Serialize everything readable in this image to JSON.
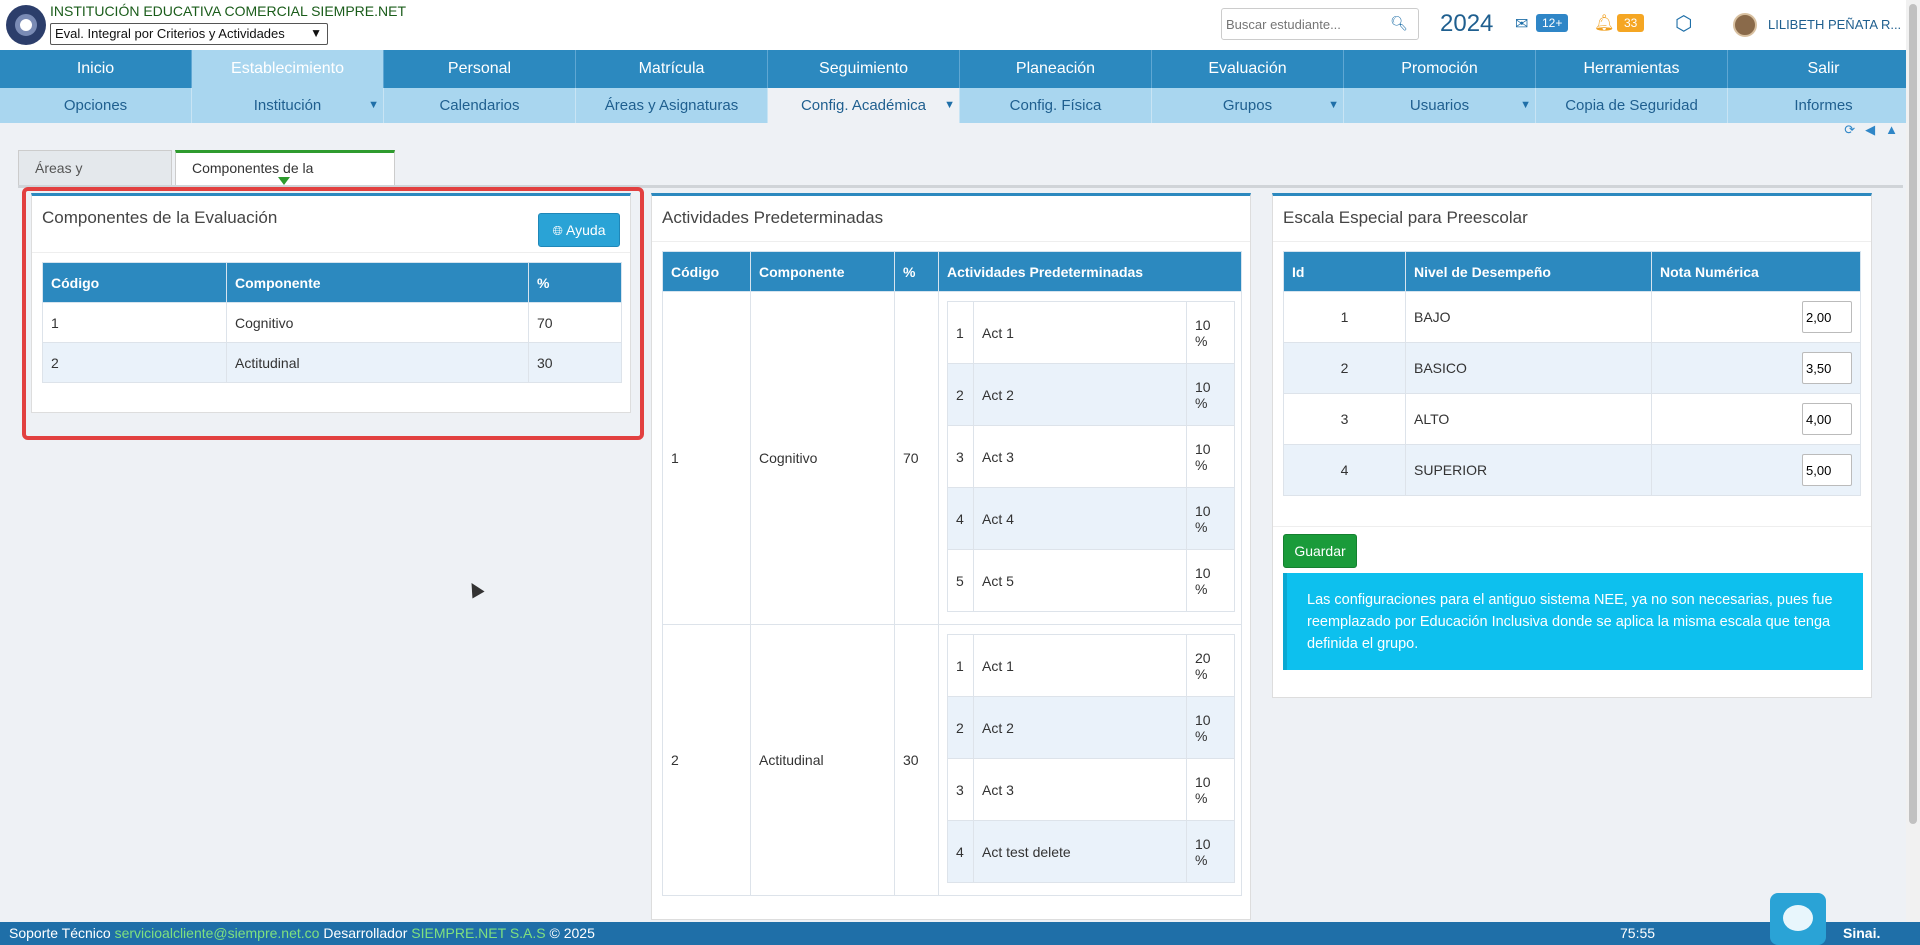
{
  "header": {
    "institution": "INSTITUCIÓN EDUCATIVA COMERCIAL SIEMPRE.NET",
    "evaluation_system": "Eval. Integral por Criterios y Actividades",
    "search_placeholder": "Buscar estudiante...",
    "year": "2024",
    "mail_count": "12+",
    "notifications_count": "33",
    "user_name": "LILIBETH PEÑATA R..."
  },
  "nav_main": [
    "Inicio",
    "Establecimiento",
    "Personal",
    "Matrícula",
    "Seguimiento",
    "Planeación",
    "Evaluación",
    "Promoción",
    "Herramientas",
    "Salir"
  ],
  "nav_sub": [
    "Opciones",
    "Institución",
    "Calendarios",
    "Áreas y Asignaturas",
    "Config. Académica",
    "Config. Física",
    "Grupos",
    "Usuarios",
    "Copia de Seguridad",
    "Informes"
  ],
  "tabs": [
    "Áreas y Asignaturas",
    "Componentes de la Evaluación"
  ],
  "components_panel": {
    "title": "Componentes de la Evaluación",
    "help_label": "Ayuda",
    "headers": [
      "Código",
      "Componente",
      "%"
    ],
    "rows": [
      [
        "1",
        "Cognitivo",
        "70"
      ],
      [
        "2",
        "Actitudinal",
        "30"
      ]
    ]
  },
  "activities_panel": {
    "title": "Actividades Predeterminadas",
    "headers": [
      "Código",
      "Componente",
      "%",
      "Actividades Predeterminadas"
    ],
    "groups": [
      {
        "code": "1",
        "component": "Cognitivo",
        "percent": "70",
        "activities": [
          [
            "1",
            "Act 1",
            "10 %"
          ],
          [
            "2",
            "Act 2",
            "10 %"
          ],
          [
            "3",
            "Act 3",
            "10 %"
          ],
          [
            "4",
            "Act 4",
            "10 %"
          ],
          [
            "5",
            "Act 5",
            "10 %"
          ]
        ]
      },
      {
        "code": "2",
        "component": "Actitudinal",
        "percent": "30",
        "activities": [
          [
            "1",
            "Act 1",
            "20 %"
          ],
          [
            "2",
            "Act 2",
            "10 %"
          ],
          [
            "3",
            "Act 3",
            "10 %"
          ],
          [
            "4",
            "Act test delete",
            "10 %"
          ]
        ]
      }
    ]
  },
  "scale_panel": {
    "title": "Escala Especial para Preescolar",
    "headers": [
      "Id",
      "Nivel de Desempeño",
      "Nota Numérica"
    ],
    "rows": [
      [
        "1",
        "BAJO",
        "2,00"
      ],
      [
        "2",
        "BASICO",
        "3,50"
      ],
      [
        "3",
        "ALTO",
        "4,00"
      ],
      [
        "4",
        "SUPERIOR",
        "5,00"
      ]
    ],
    "save_label": "Guardar",
    "info": "Las configuraciones para el antiguo sistema NEE, ya no son necesarias, pues fue reemplazado por Educación Inclusiva donde se aplica la misma escala que tenga definida el grupo."
  },
  "footer": {
    "support_label": "Soporte Técnico",
    "support_email": "servicioalcliente@siempre.net.co",
    "developer_label": "Desarrollador",
    "developer": "SIEMPRE.NET S.A.S",
    "copyright": "© 2025",
    "timer": "75:55",
    "brand": "Sinai."
  }
}
